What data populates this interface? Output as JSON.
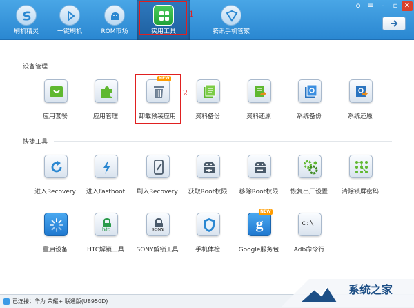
{
  "nav": {
    "items": [
      {
        "label": "刷机精灵",
        "icon": "shuaji-logo-icon"
      },
      {
        "label": "一键刷机",
        "icon": "play-icon"
      },
      {
        "label": "ROM市场",
        "icon": "android-icon"
      },
      {
        "label": "实用工具",
        "icon": "grid-icon",
        "active": true
      },
      {
        "label": "腾讯手机管家",
        "icon": "shield-icon"
      }
    ],
    "marker": "1"
  },
  "sections": {
    "device": {
      "title": "设备管理",
      "tiles": [
        {
          "label": "应用套餐",
          "icon": "shopping-bag-icon"
        },
        {
          "label": "应用管理",
          "icon": "puzzle-icon"
        },
        {
          "label": "卸载预装应用",
          "icon": "trash-icon",
          "badge": "NEW"
        },
        {
          "label": "资料备份",
          "icon": "document-backup-icon"
        },
        {
          "label": "资料还原",
          "icon": "document-restore-icon"
        },
        {
          "label": "系统备份",
          "icon": "system-backup-icon"
        },
        {
          "label": "系统还原",
          "icon": "system-restore-icon"
        }
      ],
      "marker": "2"
    },
    "quick": {
      "title": "快捷工具",
      "tiles": [
        {
          "label": "进入Recovery",
          "icon": "refresh-icon"
        },
        {
          "label": "进入Fastboot",
          "icon": "lightning-icon"
        },
        {
          "label": "刷入Recovery",
          "icon": "phone-edit-icon"
        },
        {
          "label": "获取Root权限",
          "icon": "root-android-icon"
        },
        {
          "label": "移除Root权限",
          "icon": "remove-root-icon"
        },
        {
          "label": "恢复出厂设置",
          "icon": "gears-icon"
        },
        {
          "label": "清除锁屏密码",
          "icon": "pattern-lock-icon"
        },
        {
          "label": "重启设备",
          "icon": "loading-icon"
        },
        {
          "label": "HTC解锁工具",
          "icon": "htc-lock-icon",
          "brand": "htc"
        },
        {
          "label": "SONY解锁工具",
          "icon": "sony-lock-icon",
          "brand": "SONY"
        },
        {
          "label": "手机体检",
          "icon": "shield-check-icon"
        },
        {
          "label": "Google服务包",
          "icon": "google-icon",
          "brand": "g",
          "badge": "NEW"
        },
        {
          "label": "Adb命令行",
          "icon": "terminal-icon",
          "brand": "c:\\_"
        }
      ]
    }
  },
  "status": {
    "text": "已连接：华为 荣耀+ 联通版(U8950D)"
  },
  "watermark": {
    "text": "系统之家"
  },
  "colors": {
    "accent": "#2a87d1",
    "highlight": "#e02020",
    "badge": "#ff9c00"
  }
}
